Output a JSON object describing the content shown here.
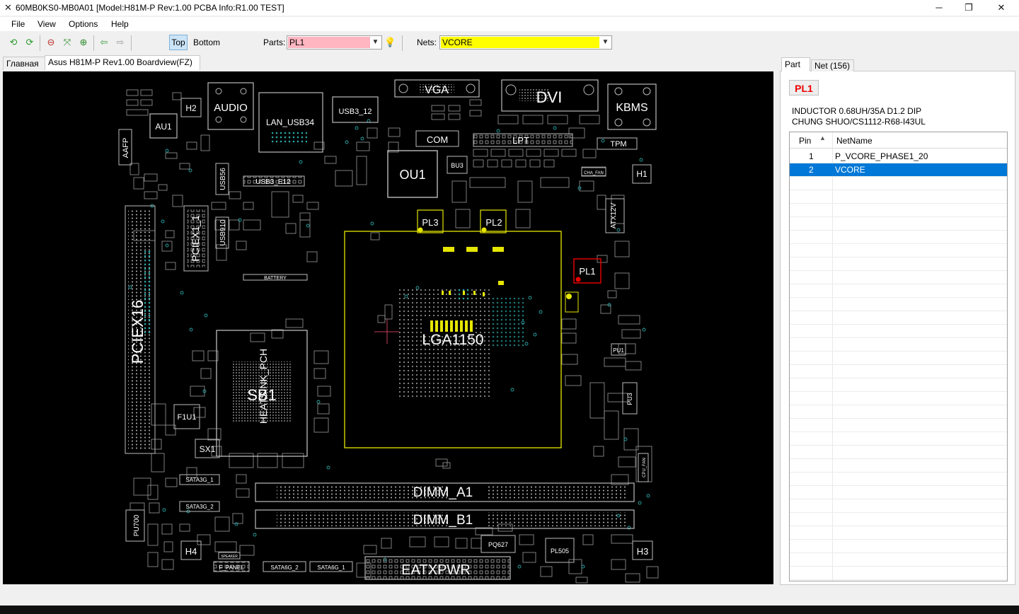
{
  "window": {
    "title": "60MB0KS0-MB0A01 [Model:H81M-P Rev:1.00 PCBA Info:R1.00 TEST]",
    "minimize": "─",
    "maximize": "❐",
    "close": "✕"
  },
  "menu": [
    "File",
    "View",
    "Options",
    "Help"
  ],
  "toolbar": {
    "top_label": "Top",
    "bottom_label": "Bottom",
    "parts_label": "Parts:",
    "parts_value": "PL1",
    "parts_color": "#ffb6c1",
    "nets_label": "Nets:",
    "nets_value": "VCORE",
    "nets_color": "#ffff00",
    "icons": [
      "rotate-left-icon",
      "rotate-right-icon",
      "zoom-out-icon",
      "zoom-fit-icon",
      "zoom-in-icon",
      "back-icon",
      "forward-icon",
      "bulb-icon"
    ]
  },
  "tabs": [
    "Главная",
    "Asus H81M-P Rev1.00 Boardview(FZ)"
  ],
  "panel": {
    "tabs": [
      "Part",
      "Net (156)"
    ],
    "part_name": "PL1",
    "desc_line1": "INDUCTOR 0.68UH/35A D1.2 DIP",
    "desc_line2": "CHUNG SHUO/CS1112-R68-I43UL",
    "col_pin": "Pin",
    "col_net": "NetName",
    "rows": [
      {
        "pin": "1",
        "net": "P_VCORE_PHASE1_20"
      },
      {
        "pin": "2",
        "net": "VCORE"
      }
    ]
  },
  "board": {
    "labels": {
      "vga": "VGA",
      "dvi": "DVI",
      "kbms": "KBMS",
      "audio": "AUDIO",
      "lan": "LAN_USB34",
      "usb3_12": "USB3_12",
      "au1": "AU1",
      "h2": "H2",
      "aafp": "AAFP",
      "com": "COM",
      "lpt": "LPT",
      "tpm": "TPM",
      "h1": "H1",
      "ou1": "OU1",
      "bu3": "BU3",
      "usb56": "USB56",
      "usb3_e12": "USB3_E12",
      "usb910": "USB910",
      "pciex1": "PCIEX1_1",
      "pciex16": "PCIEX16",
      "battery": "BATTERY",
      "pl3": "PL3",
      "pl2": "PL2",
      "pl1": "PL1",
      "atx12v": "ATX12V",
      "lga": "LGA1150",
      "pu1": "PU1",
      "pu3": "PU3",
      "sb": "SB1",
      "heatsink": "HEATSINK_PCH",
      "f1u1": "F1U1",
      "sx1": "SX1",
      "sata1": "SATA3G_1",
      "sata2": "SATA3G_2",
      "dimm_a1": "DIMM_A1",
      "dimm_b1": "DIMM_B1",
      "pu700": "PU700",
      "h4": "H4",
      "f_panel": "F_PANEL",
      "sata6g2": "SATA6G_2",
      "sata6g1": "SATA6G_1",
      "eatx": "EATXPWR",
      "pq627": "PQ627",
      "pl505": "PL505",
      "h3": "H3",
      "cha_fan": "CHA_FAN",
      "cpu_fan": "CPU_FAN",
      "speaker": "SPEAKER"
    }
  }
}
